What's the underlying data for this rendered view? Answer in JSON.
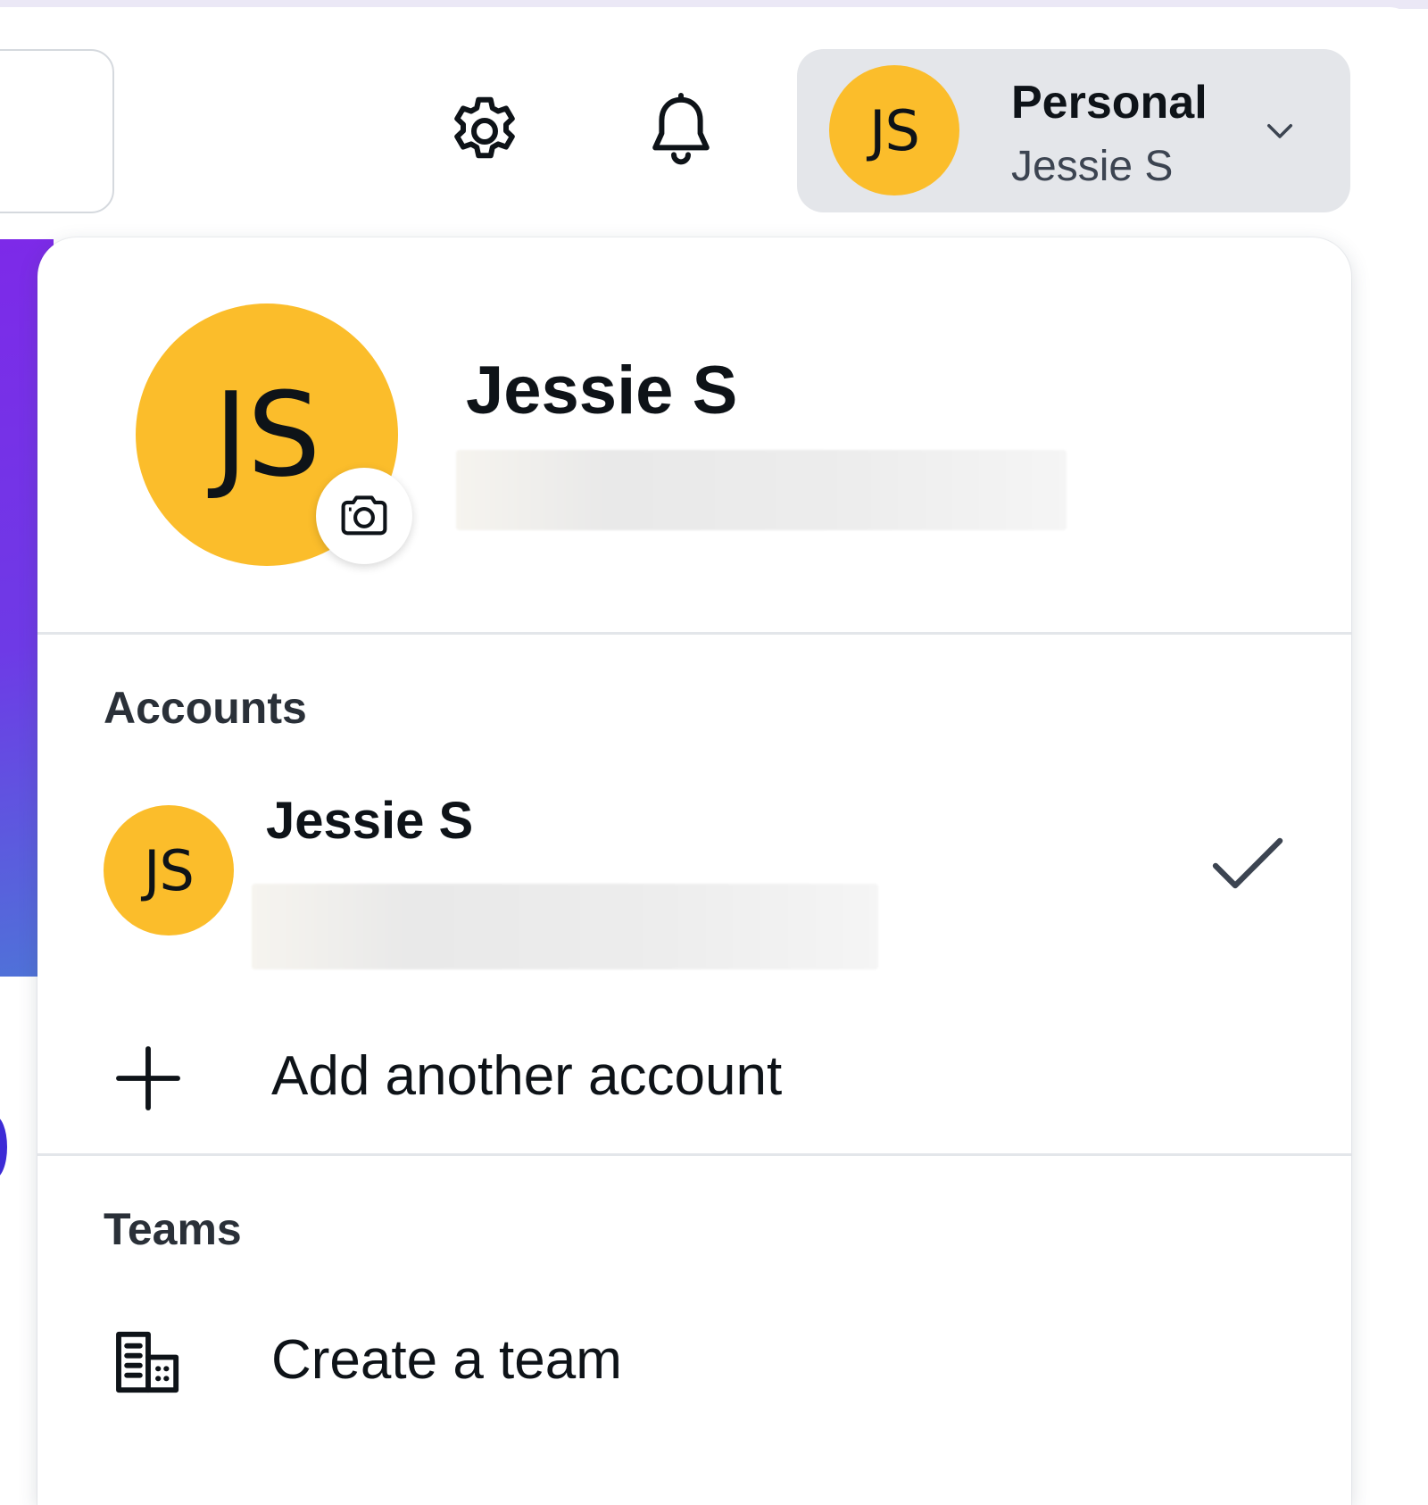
{
  "header": {
    "settings_icon": "gear-icon",
    "notifications_icon": "bell-icon",
    "account_switcher": {
      "avatar_initials": "JS",
      "title": "Personal",
      "subtitle": "Jessie S",
      "chevron_icon": "chevron-down-icon"
    }
  },
  "dropdown": {
    "profile": {
      "avatar_initials": "JS",
      "camera_icon": "camera-icon",
      "name": "Jessie S"
    },
    "accounts": {
      "heading": "Accounts",
      "items": [
        {
          "avatar_initials": "JS",
          "name": "Jessie S",
          "selected": true,
          "check_icon": "check-icon"
        }
      ],
      "add_label": "Add another account",
      "add_icon": "plus-icon"
    },
    "teams": {
      "heading": "Teams",
      "create_label": "Create a team",
      "create_icon": "building-icon"
    }
  },
  "colors": {
    "avatar": "#fbbd2b",
    "switcher_bg": "#e4e6ea",
    "text": "#0e1318",
    "accent_purple": "#7d2ae8"
  }
}
